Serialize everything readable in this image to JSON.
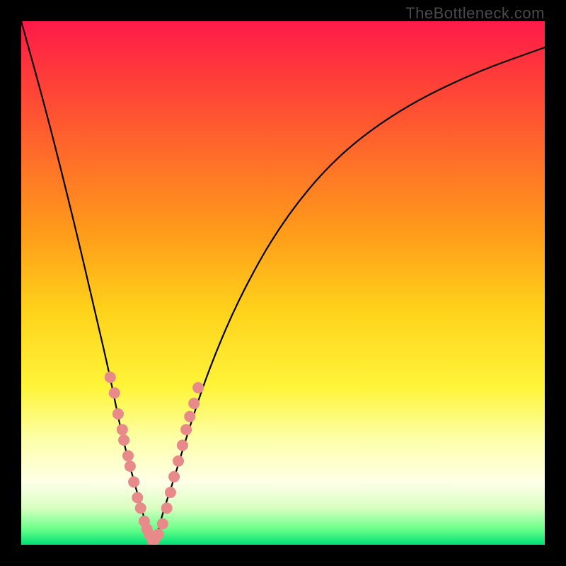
{
  "watermark": "TheBottleneck.com",
  "gradient": {
    "stops": [
      {
        "pos": 0.0,
        "color": "#ff1a4a"
      },
      {
        "pos": 0.1,
        "color": "#ff3a3a"
      },
      {
        "pos": 0.25,
        "color": "#ff6a2a"
      },
      {
        "pos": 0.4,
        "color": "#ff9a1a"
      },
      {
        "pos": 0.55,
        "color": "#ffd11a"
      },
      {
        "pos": 0.7,
        "color": "#fff53a"
      },
      {
        "pos": 0.8,
        "color": "#fdffaa"
      },
      {
        "pos": 0.88,
        "color": "#ffffe8"
      },
      {
        "pos": 0.93,
        "color": "#d8ffc0"
      },
      {
        "pos": 0.97,
        "color": "#6aff8a"
      },
      {
        "pos": 1.0,
        "color": "#00e075"
      }
    ]
  },
  "chart_data": {
    "type": "line",
    "title": "",
    "xlabel": "",
    "ylabel": "",
    "xlim": [
      0,
      100
    ],
    "ylim": [
      0,
      100
    ],
    "x_optimum": 25,
    "series": [
      {
        "name": "bottleneck-curve",
        "x": [
          0,
          5,
          10,
          14,
          17,
          19,
          21,
          23,
          24,
          25,
          26,
          27,
          29,
          32,
          36,
          42,
          50,
          60,
          72,
          86,
          100
        ],
        "y": [
          100,
          82,
          62,
          45,
          32,
          22,
          14,
          7,
          3,
          0,
          2,
          6,
          12,
          22,
          34,
          48,
          62,
          74,
          83,
          90,
          95
        ]
      }
    ],
    "marker_cluster": {
      "name": "highlighted-points",
      "color": "#e98a8a",
      "radius": 8,
      "points": [
        {
          "x": 17.0,
          "y": 32.0
        },
        {
          "x": 17.8,
          "y": 29.0
        },
        {
          "x": 18.5,
          "y": 25.0
        },
        {
          "x": 19.3,
          "y": 22.0
        },
        {
          "x": 19.6,
          "y": 20.0
        },
        {
          "x": 20.4,
          "y": 17.0
        },
        {
          "x": 20.8,
          "y": 15.0
        },
        {
          "x": 21.5,
          "y": 12.0
        },
        {
          "x": 22.2,
          "y": 9.0
        },
        {
          "x": 22.8,
          "y": 7.0
        },
        {
          "x": 23.5,
          "y": 4.5
        },
        {
          "x": 24.0,
          "y": 3.0
        },
        {
          "x": 24.5,
          "y": 2.0
        },
        {
          "x": 25.0,
          "y": 1.0
        },
        {
          "x": 25.5,
          "y": 1.0
        },
        {
          "x": 26.2,
          "y": 2.0
        },
        {
          "x": 27.0,
          "y": 4.0
        },
        {
          "x": 27.8,
          "y": 7.0
        },
        {
          "x": 28.5,
          "y": 10.0
        },
        {
          "x": 29.2,
          "y": 13.0
        },
        {
          "x": 30.0,
          "y": 16.0
        },
        {
          "x": 30.8,
          "y": 19.0
        },
        {
          "x": 31.5,
          "y": 22.0
        },
        {
          "x": 32.2,
          "y": 24.5
        },
        {
          "x": 33.0,
          "y": 27.0
        },
        {
          "x": 33.8,
          "y": 30.0
        }
      ]
    }
  }
}
